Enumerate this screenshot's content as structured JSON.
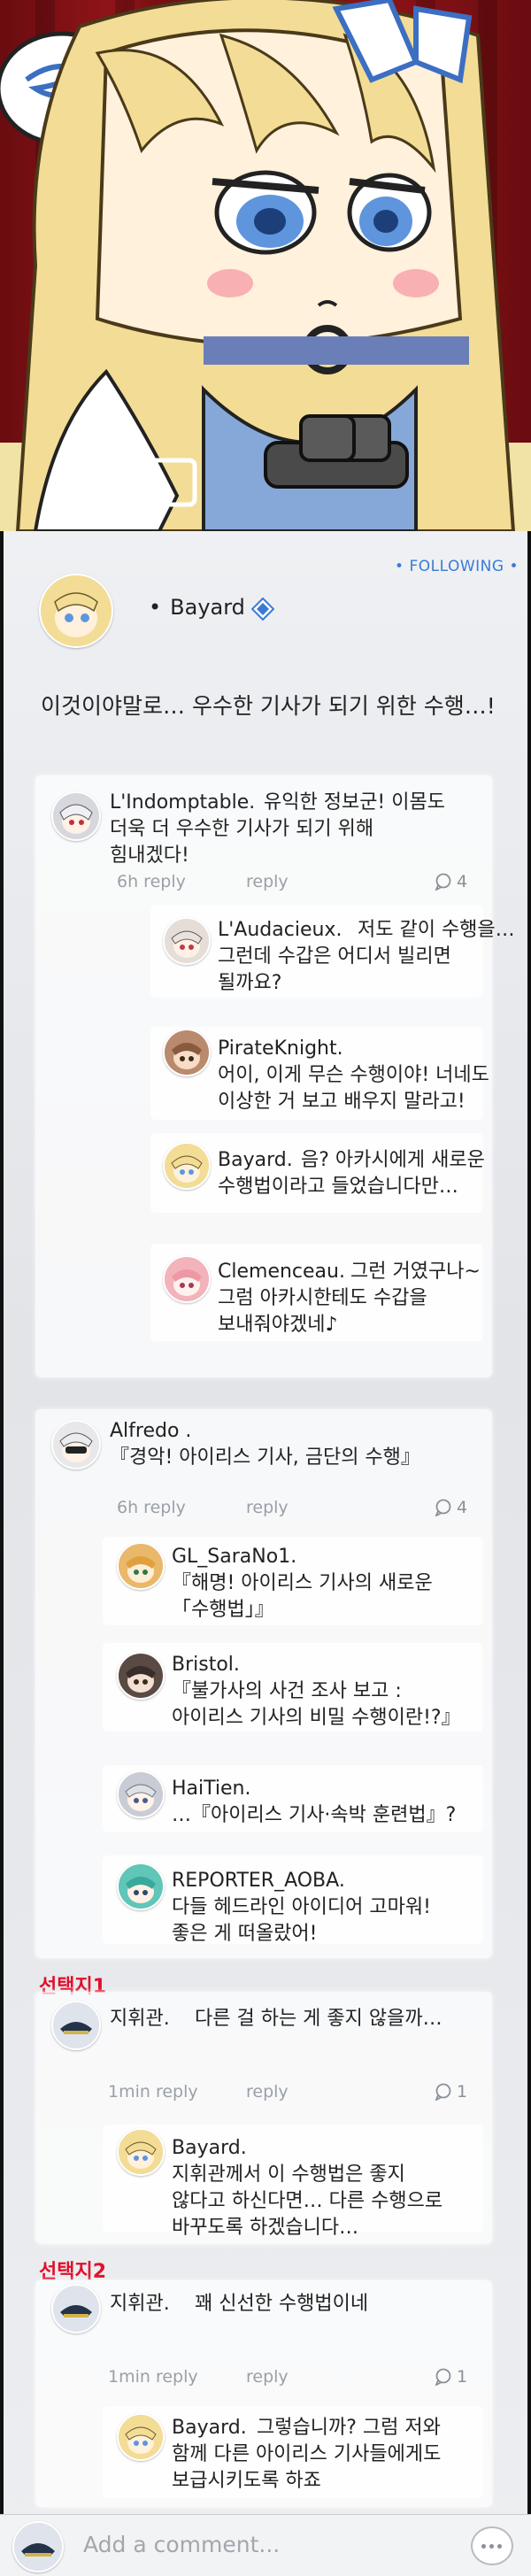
{
  "post": {
    "following_label": "• FOLLOWING •",
    "author": "Bayard",
    "text": "이것이야말로… 우수한 기사가 되기 위한 수행…!"
  },
  "threads": [
    {
      "author": "L'Indomptable.",
      "text_line1": "유익한 정보군! 이몸도",
      "text_line2": "더욱 더 우수한 기사가 되기 위해",
      "text_line3": "힘내겠다!",
      "time": "6h reply",
      "reply_label": "reply",
      "count": "4",
      "replies": [
        {
          "author": "L'Audacieux.",
          "l1": "저도 같이 수행을…",
          "l2": "그런데 수갑은 어디서 빌리면",
          "l3": "될까요?"
        },
        {
          "author": "PirateKnight.",
          "l1": "",
          "l2": "어이, 이게 무슨 수행이야! 너네도",
          "l3": "이상한 거 보고 배우지 말라고!"
        },
        {
          "author": "Bayard.",
          "l1": "음? 아카시에게 새로운",
          "l2": "수행법이라고 들었습니다만…",
          "l3": ""
        },
        {
          "author": "Clemenceau.",
          "l1": "그런 거였구나~",
          "l2": "그럼 아카시한테도 수갑을",
          "l3": "보내줘야겠네♪"
        }
      ]
    },
    {
      "author": "Alfredo .",
      "text_line1": "『경악! 아이리스 기사, 금단의 수행』",
      "time": "6h reply",
      "reply_label": "reply",
      "count": "4",
      "replies": [
        {
          "author": "GL_SaraNo1.",
          "l1": "",
          "l2": "『해명! 아이리스 기사의 새로운",
          "l3": "「수행법」』"
        },
        {
          "author": "Bristol.",
          "l1": "",
          "l2": "『불가사의 사건 조사 보고 :",
          "l3": "아이리스 기사의 비밀 수행이란!?』"
        },
        {
          "author": "HaiTien.",
          "l1": "",
          "l2": "…『아이리스 기사·속박 훈련법』?",
          "l3": ""
        },
        {
          "author": "REPORTER_AOBA.",
          "l1": "",
          "l2": "다들 헤드라인 아이디어 고마워!",
          "l3": "좋은 게 떠올랐어!"
        }
      ]
    }
  ],
  "choices": [
    {
      "label": "선택지1",
      "commander": "지휘관.",
      "text": "다른 걸 하는 게 좋지 않을까…",
      "time": "1min reply",
      "reply_label": "reply",
      "count": "1",
      "reply": {
        "author": "Bayard.",
        "l1": "",
        "l2": "지휘관께서 이 수행법은 좋지",
        "l3": "않다고 하신다면… 다른 수행으로",
        "l4": "바꾸도록 하겠습니다…"
      }
    },
    {
      "label": "선택지2",
      "commander": "지휘관.",
      "text": "꽤 신선한 수행법이네",
      "time": "1min reply",
      "reply_label": "reply",
      "count": "1",
      "reply": {
        "author": "Bayard.",
        "l1": "그렇습니까? 그럼 저와",
        "l2": "함께 다른 아이리스 기사들에게도",
        "l3": "보급시키도록 하죠"
      }
    }
  ],
  "input": {
    "placeholder": "Add a comment..."
  },
  "colors": {
    "accent": "#3a7bd5",
    "choice_red": "#e0102a",
    "curtain": "#8e1418"
  }
}
